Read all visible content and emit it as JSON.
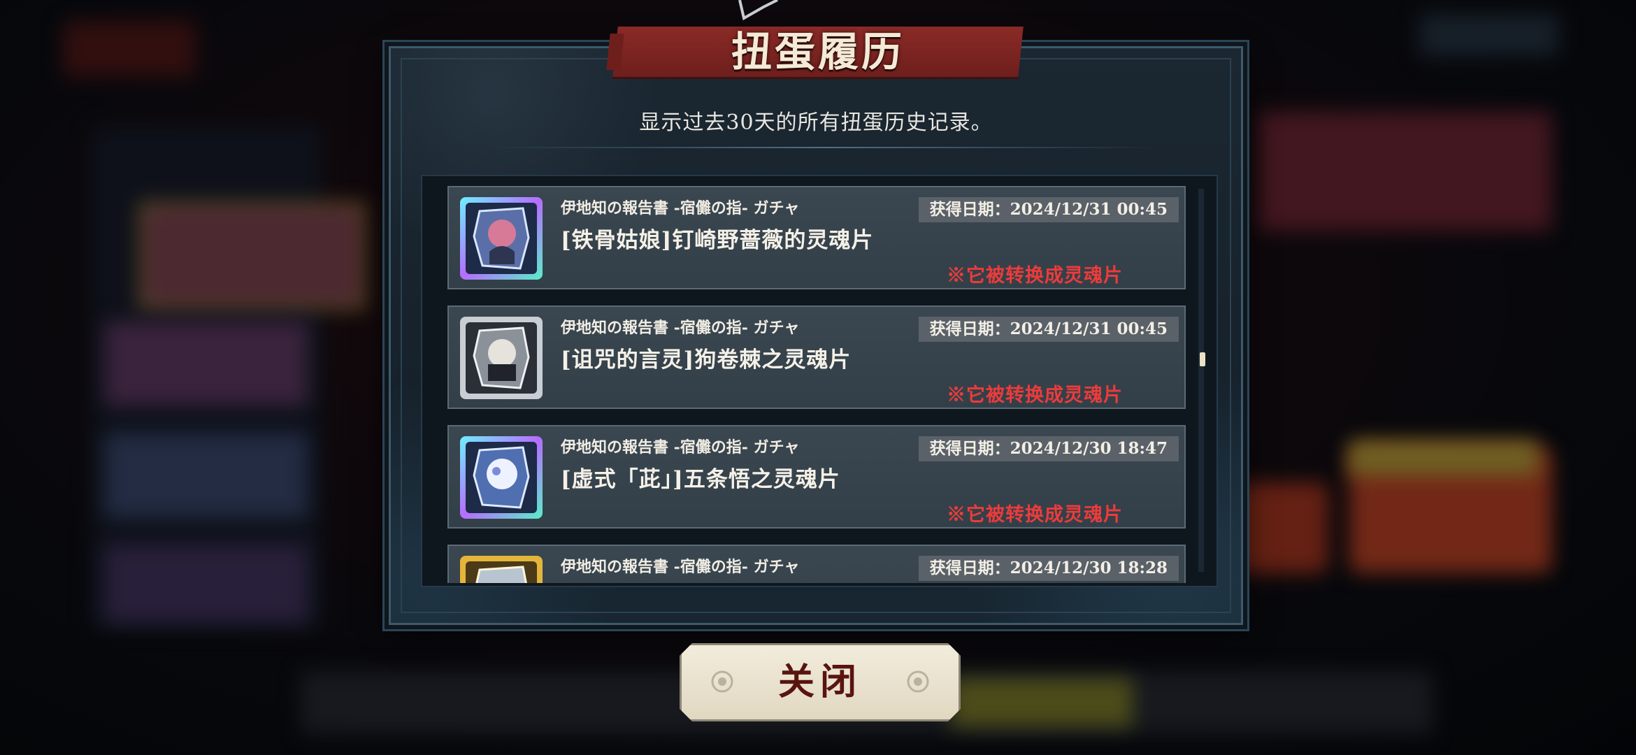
{
  "dialog": {
    "title": "扭蛋履历",
    "subtitle": "显示过去30天的所有扭蛋历史记录。"
  },
  "entries": [
    {
      "source": "伊地知の報告書 -宿儺の指- ガチャ",
      "name": "[铁骨姑娘]钉崎野蔷薇的灵魂片",
      "date": "获得日期：2024/12/31 00:45",
      "note": "※它被转换成灵魂片",
      "frame_color": "#5fd6f0",
      "icon": "nobara-soul-fragment-icon"
    },
    {
      "source": "伊地知の報告書 -宿儺の指- ガチャ",
      "name": "[诅咒的言灵]狗卷棘之灵魂片",
      "date": "获得日期：2024/12/31 00:45",
      "note": "※它被转换成灵魂片",
      "frame_color": "#c9ced4",
      "icon": "inumaki-soul-fragment-icon"
    },
    {
      "source": "伊地知の報告書 -宿儺の指- ガチャ",
      "name": "[虚式「茈」]五条悟之灵魂片",
      "date": "获得日期：2024/12/30 18:47",
      "note": "※它被转换成灵魂片",
      "frame_color": "#5fd6f0",
      "icon": "gojo-soul-fragment-icon"
    },
    {
      "source": "伊地知の報告書 -宿儺の指- ガチャ",
      "name": "",
      "date": "获得日期：2024/12/30 18:28",
      "note": "",
      "frame_color": "#e3b53a",
      "icon": "gold-soul-fragment-icon"
    }
  ],
  "close_button": {
    "label": "关闭"
  },
  "colors": {
    "title_banner": "#8a2a26",
    "note_red": "#ec3b3b",
    "entry_bg": "#3a4750"
  }
}
